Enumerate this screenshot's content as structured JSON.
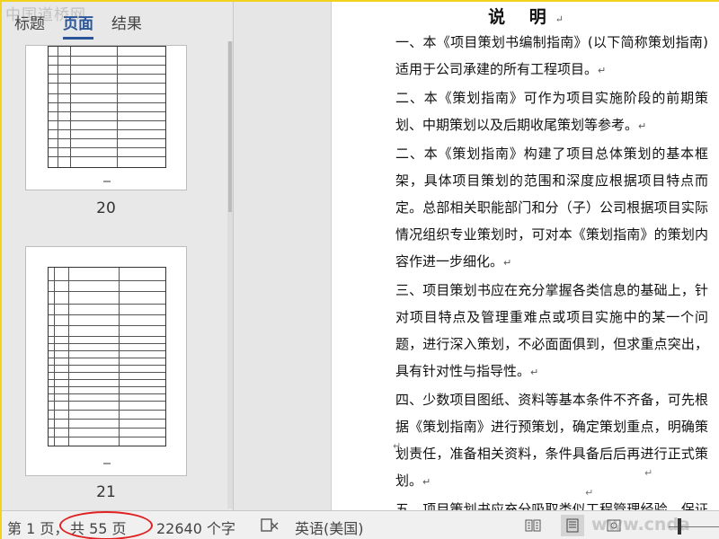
{
  "watermark_top": "中国道桥网",
  "nav": {
    "tabs": [
      {
        "label": "标题"
      },
      {
        "label": "页面"
      },
      {
        "label": "结果"
      }
    ],
    "thumbnails": [
      {
        "page_number": "20"
      },
      {
        "page_number": "21"
      }
    ]
  },
  "document": {
    "title": "说 明",
    "paragraph_mark": "↵",
    "paragraphs": [
      "一、本《项目策划书编制指南》(以下简称策划指南)适用于公司承建的所有工程项目。",
      "二、本《策划指南》可作为项目实施阶段的前期策划、中期策划以及后期收尾策划等参考。",
      "二、本《策划指南》构建了项目总体策划的基本框架，具体项目策划的范围和深度应根据项目特点而定。总部相关职能部门和分（子）公司根据项目实际情况组织专业策划时，可对本《策划指南》的策划内容作进一步细化。",
      "三、项目策划书应在充分掌握各类信息的基础上，针对项目特点及管理重难点或项目实施中的某一个问题，进行深入策划，不必面面俱到，但求重点突出，具有针对性与指导性。",
      "四、少数项目图纸、资料等基本条件不齐备，可先根据《策划指南》进行预策划，确定策划重点，明确策划责任，准备相关资料，条件具备后后再进行正式策划。",
      "五、项目策划书应充分吸取类似工程管理经验，保证质量，具备可操作性。"
    ]
  },
  "status_bar": {
    "page_label": "第 1 页，",
    "total_pages": "共 55 页",
    "word_count": "22640 个字",
    "language": "英语(美国)",
    "icons": [
      "proofing-icon",
      "read-mode-icon",
      "print-layout-icon",
      "web-layout-icon"
    ],
    "site_watermark": "www.cnda o.com",
    "highlight_color": "#e02020"
  }
}
